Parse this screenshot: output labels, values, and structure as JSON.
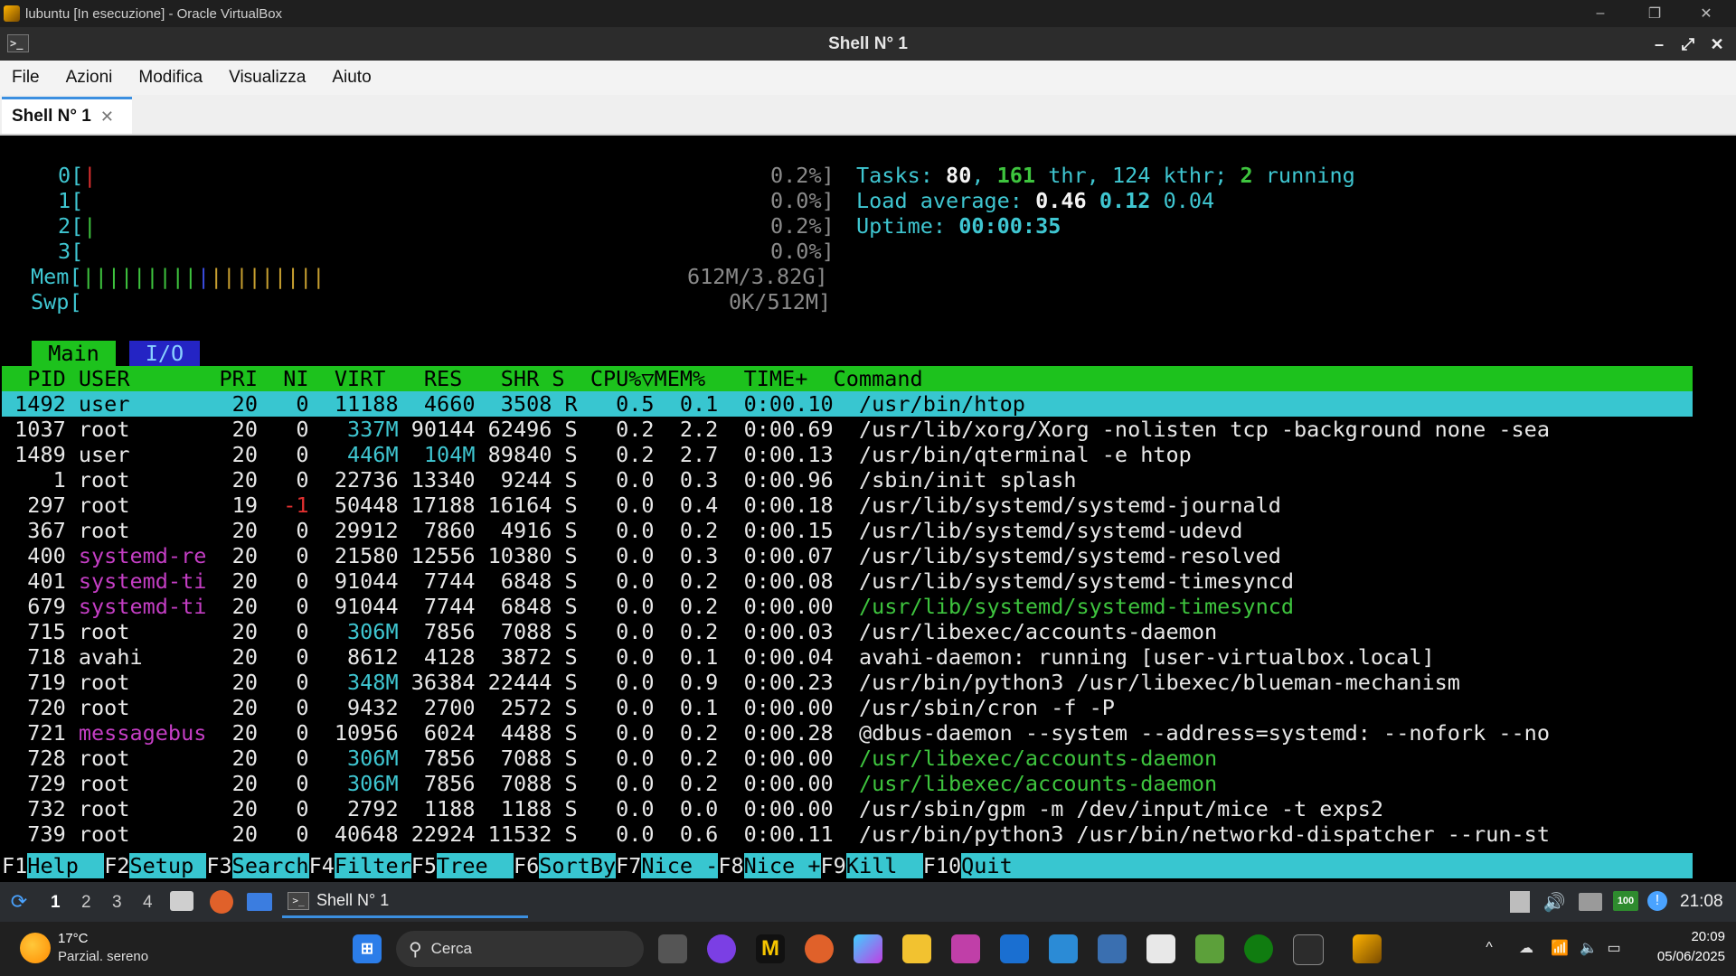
{
  "vbox": {
    "title": "lubuntu [In esecuzione] - Oracle VirtualBox",
    "minimize": "–",
    "maximize": "❐",
    "close": "✕"
  },
  "qt_window": {
    "title": "Shell N° 1",
    "icon_glyph": ">_",
    "minimize": "–",
    "restore": "⤢",
    "close": "✕"
  },
  "menu": [
    "File",
    "Azioni",
    "Modifica",
    "Visualizza",
    "Aiuto"
  ],
  "tab": {
    "label": "Shell N° 1",
    "close": "✕"
  },
  "htop": {
    "cpu_rows": [
      {
        "label": "0[",
        "bar": "|",
        "bar_color": "red",
        "value": "0.2%]"
      },
      {
        "label": "1[",
        "bar": "",
        "bar_color": "none",
        "value": "0.0%]"
      },
      {
        "label": "2[",
        "bar": "|",
        "bar_color": "green",
        "value": "0.2%]"
      },
      {
        "label": "3[",
        "bar": "",
        "bar_color": "none",
        "value": "0.0%]"
      }
    ],
    "mem": {
      "label": "Mem[",
      "value": "612M/3.82G]"
    },
    "swp": {
      "label": "Swp[",
      "value": "0K/512M]"
    },
    "tasks": {
      "prefix": "Tasks: ",
      "tasks": "80",
      "sep1": ", ",
      "thr": "161",
      "thr_label": " thr, ",
      "kthr": "124",
      "kthr_label": " kthr; ",
      "running": "2",
      "running_label": " running"
    },
    "load": {
      "prefix": "Load average: ",
      "l1": "0.46",
      "l5": "0.12",
      "l15": "0.04"
    },
    "uptime": {
      "prefix": "Uptime: ",
      "value": "00:00:35"
    },
    "tabs": {
      "main": "Main",
      "io": "I/O"
    },
    "header": "  PID USER       PRI  NI  VIRT   RES   SHR S  CPU%▽MEM%   TIME+  Command",
    "processes": [
      {
        "pid": "1492",
        "user": "user",
        "pri": "20",
        "ni": "0",
        "virt": "11188",
        "res": "4660",
        "shr": "3508",
        "s": "R",
        "cpu": "0.5",
        "mem": "0.1",
        "time": "0:00.10",
        "cmd": "/usr/bin/htop",
        "selected": true
      },
      {
        "pid": "1037",
        "user": "root",
        "pri": "20",
        "ni": "0",
        "virt": "337M",
        "res": "90144",
        "shr": "62496",
        "s": "S",
        "cpu": "0.2",
        "mem": "2.2",
        "time": "0:00.69",
        "cmd": "/usr/lib/xorg/Xorg -nolisten tcp -background none -sea"
      },
      {
        "pid": "1489",
        "user": "user",
        "pri": "20",
        "ni": "0",
        "virt": "446M",
        "res": "104M",
        "shr": "89840",
        "s": "S",
        "cpu": "0.2",
        "mem": "2.7",
        "time": "0:00.13",
        "cmd": "/usr/bin/qterminal -e htop"
      },
      {
        "pid": "1",
        "user": "root",
        "pri": "20",
        "ni": "0",
        "virt": "22736",
        "res": "13340",
        "shr": "9244",
        "s": "S",
        "cpu": "0.0",
        "mem": "0.3",
        "time": "0:00.96",
        "cmd": "/sbin/init splash"
      },
      {
        "pid": "297",
        "user": "root",
        "pri": "19",
        "ni": "-1",
        "virt": "50448",
        "res": "17188",
        "shr": "16164",
        "s": "S",
        "cpu": "0.0",
        "mem": "0.4",
        "time": "0:00.18",
        "cmd": "/usr/lib/systemd/systemd-journald"
      },
      {
        "pid": "367",
        "user": "root",
        "pri": "20",
        "ni": "0",
        "virt": "29912",
        "res": "7860",
        "shr": "4916",
        "s": "S",
        "cpu": "0.0",
        "mem": "0.2",
        "time": "0:00.15",
        "cmd": "/usr/lib/systemd/systemd-udevd"
      },
      {
        "pid": "400",
        "user": "systemd-re",
        "pri": "20",
        "ni": "0",
        "virt": "21580",
        "res": "12556",
        "shr": "10380",
        "s": "S",
        "cpu": "0.0",
        "mem": "0.3",
        "time": "0:00.07",
        "cmd": "/usr/lib/systemd/systemd-resolved"
      },
      {
        "pid": "401",
        "user": "systemd-ti",
        "pri": "20",
        "ni": "0",
        "virt": "91044",
        "res": "7744",
        "shr": "6848",
        "s": "S",
        "cpu": "0.0",
        "mem": "0.2",
        "time": "0:00.08",
        "cmd": "/usr/lib/systemd/systemd-timesyncd"
      },
      {
        "pid": "679",
        "user": "systemd-ti",
        "pri": "20",
        "ni": "0",
        "virt": "91044",
        "res": "7744",
        "shr": "6848",
        "s": "S",
        "cpu": "0.0",
        "mem": "0.2",
        "time": "0:00.00",
        "cmd": "/usr/lib/systemd/systemd-timesyncd",
        "thread": true
      },
      {
        "pid": "715",
        "user": "root",
        "pri": "20",
        "ni": "0",
        "virt": "306M",
        "res": "7856",
        "shr": "7088",
        "s": "S",
        "cpu": "0.0",
        "mem": "0.2",
        "time": "0:00.03",
        "cmd": "/usr/libexec/accounts-daemon"
      },
      {
        "pid": "718",
        "user": "avahi",
        "pri": "20",
        "ni": "0",
        "virt": "8612",
        "res": "4128",
        "shr": "3872",
        "s": "S",
        "cpu": "0.0",
        "mem": "0.1",
        "time": "0:00.04",
        "cmd": "avahi-daemon: running [user-virtualbox.local]"
      },
      {
        "pid": "719",
        "user": "root",
        "pri": "20",
        "ni": "0",
        "virt": "348M",
        "res": "36384",
        "shr": "22444",
        "s": "S",
        "cpu": "0.0",
        "mem": "0.9",
        "time": "0:00.23",
        "cmd": "/usr/bin/python3 /usr/libexec/blueman-mechanism"
      },
      {
        "pid": "720",
        "user": "root",
        "pri": "20",
        "ni": "0",
        "virt": "9432",
        "res": "2700",
        "shr": "2572",
        "s": "S",
        "cpu": "0.0",
        "mem": "0.1",
        "time": "0:00.00",
        "cmd": "/usr/sbin/cron -f -P"
      },
      {
        "pid": "721",
        "user": "messagebus",
        "pri": "20",
        "ni": "0",
        "virt": "10956",
        "res": "6024",
        "shr": "4488",
        "s": "S",
        "cpu": "0.0",
        "mem": "0.2",
        "time": "0:00.28",
        "cmd": "@dbus-daemon --system --address=systemd: --nofork --no"
      },
      {
        "pid": "728",
        "user": "root",
        "pri": "20",
        "ni": "0",
        "virt": "306M",
        "res": "7856",
        "shr": "7088",
        "s": "S",
        "cpu": "0.0",
        "mem": "0.2",
        "time": "0:00.00",
        "cmd": "/usr/libexec/accounts-daemon",
        "thread": true
      },
      {
        "pid": "729",
        "user": "root",
        "pri": "20",
        "ni": "0",
        "virt": "306M",
        "res": "7856",
        "shr": "7088",
        "s": "S",
        "cpu": "0.0",
        "mem": "0.2",
        "time": "0:00.00",
        "cmd": "/usr/libexec/accounts-daemon",
        "thread": true
      },
      {
        "pid": "732",
        "user": "root",
        "pri": "20",
        "ni": "0",
        "virt": "2792",
        "res": "1188",
        "shr": "1188",
        "s": "S",
        "cpu": "0.0",
        "mem": "0.0",
        "time": "0:00.00",
        "cmd": "/usr/sbin/gpm -m /dev/input/mice -t exps2"
      },
      {
        "pid": "739",
        "user": "root",
        "pri": "20",
        "ni": "0",
        "virt": "40648",
        "res": "22924",
        "shr": "11532",
        "s": "S",
        "cpu": "0.0",
        "mem": "0.6",
        "time": "0:00.11",
        "cmd": "/usr/bin/python3 /usr/bin/networkd-dispatcher --run-st"
      }
    ],
    "fkeys": [
      {
        "key": "F1",
        "label": "Help  "
      },
      {
        "key": "F2",
        "label": "Setup "
      },
      {
        "key": "F3",
        "label": "Search"
      },
      {
        "key": "F4",
        "label": "Filter"
      },
      {
        "key": "F5",
        "label": "Tree  "
      },
      {
        "key": "F6",
        "label": "SortBy"
      },
      {
        "key": "F7",
        "label": "Nice -"
      },
      {
        "key": "F8",
        "label": "Nice +"
      },
      {
        "key": "F9",
        "label": "Kill  "
      },
      {
        "key": "F10",
        "label": "Quit"
      }
    ]
  },
  "lxqt_panel": {
    "workspaces": [
      "1",
      "2",
      "3",
      "4"
    ],
    "task_label": "Shell N° 1",
    "clock": "21:08",
    "battery": "100"
  },
  "windows_taskbar": {
    "weather_temp": "17°C",
    "weather_desc": "Parzial. sereno",
    "search_placeholder": "Cerca",
    "time": "20:09",
    "date": "05/06/2025"
  }
}
